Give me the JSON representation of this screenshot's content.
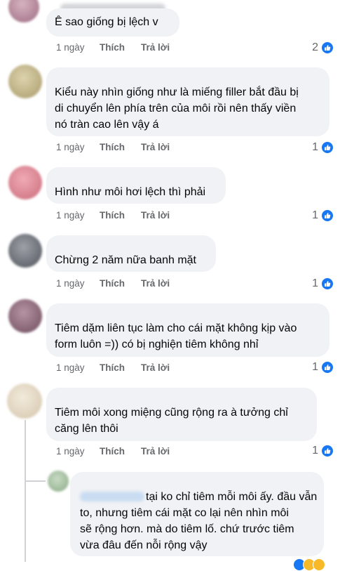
{
  "comments": [
    {
      "text_lines": [
        "Ê sao giống bị lệch v"
      ],
      "time": "1 ngày",
      "like": "Thích",
      "reply": "Trả lời",
      "reactions": "2",
      "avatar_color": "#b9879a"
    },
    {
      "text_lines": [
        "Kiểu này nhìn giống như là miếng filler bắt đầu bị",
        "di chuyển lên phía trên của môi rồi nên thấy viền",
        "nó tràn cao lên vậy á"
      ],
      "time": "1 ngày",
      "like": "Thích",
      "reply": "Trả lời",
      "reactions": "1",
      "avatar_color": "#c4b889"
    },
    {
      "text_lines": [
        "Hình như môi hơi lệch thì phải"
      ],
      "time": "1 ngày",
      "like": "Thích",
      "reply": "Trả lời",
      "reactions": "1",
      "avatar_color": "#e08a96"
    },
    {
      "text_lines": [
        "Chừng 2 năm nữa banh mặt"
      ],
      "time": "1 ngày",
      "like": "Thích",
      "reply": "Trả lời",
      "reactions": "1",
      "avatar_color": "#6a6e75"
    },
    {
      "text_lines": [
        "Tiêm dặm liên tục làm cho cái mặt không kịp vào",
        "form luôn =)) có bị nghiện tiêm không nhỉ"
      ],
      "time": "1 ngày",
      "like": "Thích",
      "reply": "Trả lời",
      "reactions": "1",
      "avatar_color": "#8c6a78"
    },
    {
      "text_lines": [
        "Tiêm môi xong miệng cũng rộng ra à tưởng chỉ",
        "căng lên thôi"
      ],
      "time": "1 ngày",
      "like": "Thích",
      "reply": "Trả lời",
      "reactions": "1",
      "avatar_color": "#e8dcc8"
    }
  ],
  "reply_comment": {
    "text_lines": [
      "tại ko chỉ tiêm mỗi môi ấy. đầu vẫn",
      "to, nhưng tiêm cái mặt co lại nên nhìn môi",
      "sẽ rộng hơn. mà do tiêm lố. chứ trước tiêm",
      "vừa đâu đến nỗi rộng vậy"
    ],
    "avatar_color": "#a9c4a4",
    "mention_color": "#c9dcf2"
  },
  "colors": {
    "like_blue": "#1877f2",
    "bubble_bg": "#f0f2f5",
    "meta_gray": "#65676b"
  }
}
